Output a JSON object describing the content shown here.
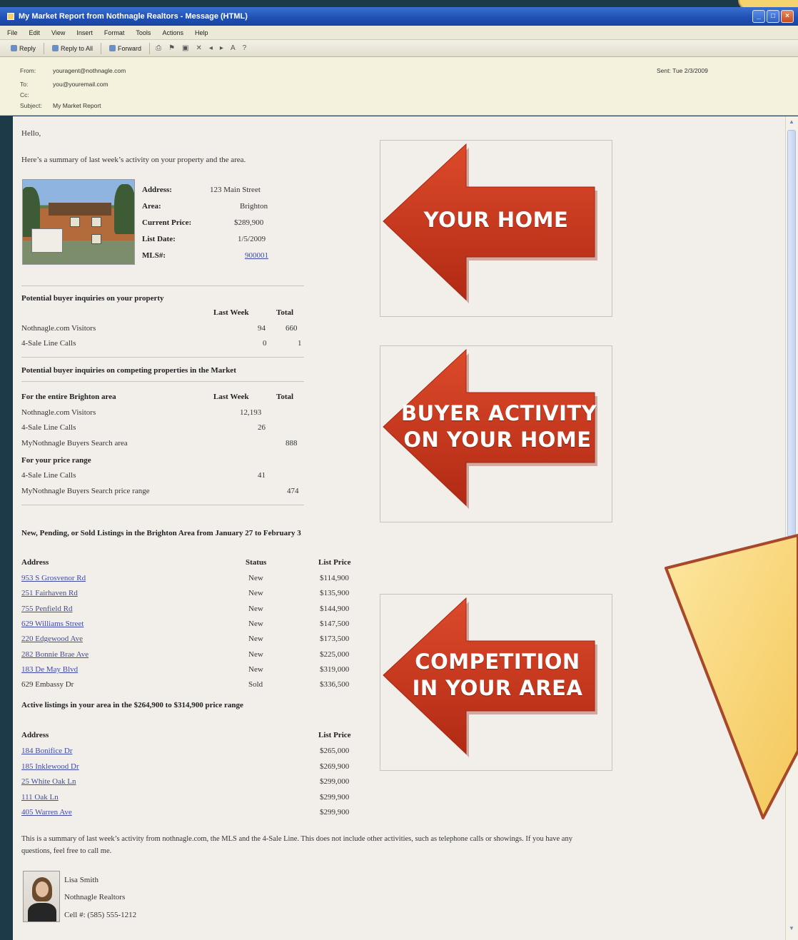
{
  "window": {
    "title": "My Market Report from Nothnagle Realtors - Message (HTML)"
  },
  "menu": [
    "File",
    "Edit",
    "View",
    "Insert",
    "Format",
    "Tools",
    "Actions",
    "Help"
  ],
  "toolbar": {
    "reply": "Reply",
    "reply_all": "Reply to All",
    "forward": "Forward"
  },
  "header": {
    "from_label": "From:",
    "from": "youragent@nothnagle.com",
    "to_label": "To:",
    "to": "you@youremail.com",
    "cc_label": "Cc:",
    "subject_label": "Subject:",
    "subject": "My Market Report",
    "sent_label": "Sent:",
    "sent": "Tue 2/3/2009"
  },
  "email": {
    "greeting": "Hello,",
    "intro": "Here’s a summary of last week’s activity on your property and the area.",
    "property": {
      "address_label": "Address:",
      "address": "123 Main Street",
      "area_label": "Area:",
      "area": "Brighton",
      "price_label": "Current Price:",
      "price": "$289,900",
      "listdate_label": "List Date:",
      "listdate": "1/5/2009",
      "mls_label": "MLS#:",
      "mls": "900001"
    },
    "inquiries": {
      "title": "Potential buyer inquiries on your property",
      "col_week": "Last Week",
      "col_total": "Total",
      "rows": [
        {
          "label": "Nothnagle.com Visitors",
          "week": "94",
          "total": "660"
        },
        {
          "label": "4-Sale Line Calls",
          "week": "0",
          "total": "1"
        }
      ]
    },
    "competing": {
      "title": "Potential buyer inquiries on competing properties in the Market",
      "area_heading": "For the entire Brighton area",
      "col_week": "Last Week",
      "col_total": "Total",
      "area_rows": [
        {
          "label": "Nothnagle.com Visitors",
          "week": "12,193",
          "total": ""
        },
        {
          "label": "4-Sale Line Calls",
          "week": "26",
          "total": ""
        },
        {
          "label": "MyNothnagle Buyers Search area",
          "week": "",
          "total": "888"
        }
      ],
      "range_heading": "For your price range",
      "range_rows": [
        {
          "label": "4-Sale Line Calls",
          "week": "41",
          "total": ""
        },
        {
          "label": "MyNothnagle Buyers Search price range",
          "week": "",
          "total": "474"
        }
      ]
    },
    "listings": {
      "title": "New, Pending, or Sold Listings in the Brighton Area from January 27 to February 3",
      "col_address": "Address",
      "col_status": "Status",
      "col_price": "List Price",
      "rows": [
        {
          "address": "953 S Grosvenor Rd",
          "status": "New",
          "price": "$114,900",
          "link": true
        },
        {
          "address": "251 Fairhaven Rd",
          "status": "New",
          "price": "$135,900",
          "link": true
        },
        {
          "address": "755 Penfield Rd",
          "status": "New",
          "price": "$144,900",
          "link": true
        },
        {
          "address": "629 Williams Street",
          "status": "New",
          "price": "$147,500",
          "link": true
        },
        {
          "address": "220 Edgewood Ave",
          "status": "New",
          "price": "$173,500",
          "link": true
        },
        {
          "address": "282 Bonnie Brae Ave",
          "status": "New",
          "price": "$225,000",
          "link": true
        },
        {
          "address": "183 De May Blvd",
          "status": "New",
          "price": "$319,000",
          "link": true
        },
        {
          "address": "629 Embassy Dr",
          "status": "Sold",
          "price": "$336,500",
          "link": false
        }
      ]
    },
    "active": {
      "title": "Active listings in your area in the $264,900 to $314,900 price range",
      "col_address": "Address",
      "col_price": "List Price",
      "rows": [
        {
          "address": "184 Bonifice Dr",
          "price": "$265,000"
        },
        {
          "address": "185 Inklewood Dr",
          "price": "$269,900"
        },
        {
          "address": "25 White Oak Ln",
          "price": "$299,000"
        },
        {
          "address": "111 Oak Ln",
          "price": "$299,900"
        },
        {
          "address": "405 Warren Ave",
          "price": "$299,900"
        }
      ]
    },
    "footer_line1": "This is a summary of last week’s activity from nothnagle.com, the MLS and the 4-Sale Line. This does not include other activities, such as telephone calls or showings. If you have any",
    "footer_line2": "questions, feel free to call me.",
    "signature": {
      "name": "Lisa Smith",
      "company": "Nothnagle Realtors",
      "cell": "Cell #: (585) 555-1212"
    }
  },
  "annotations": {
    "your_home": "YOUR HOME",
    "buyer_activity_1": "BUYER ACTIVITY",
    "buyer_activity_2": "ON YOUR HOME",
    "competition_1": "COMPETITION",
    "competition_2": "IN YOUR AREA"
  },
  "colors": {
    "arrow": "#c8361b",
    "callout": "#f8d672",
    "link": "#3e4aa6",
    "titlebar": "#2456bd"
  }
}
